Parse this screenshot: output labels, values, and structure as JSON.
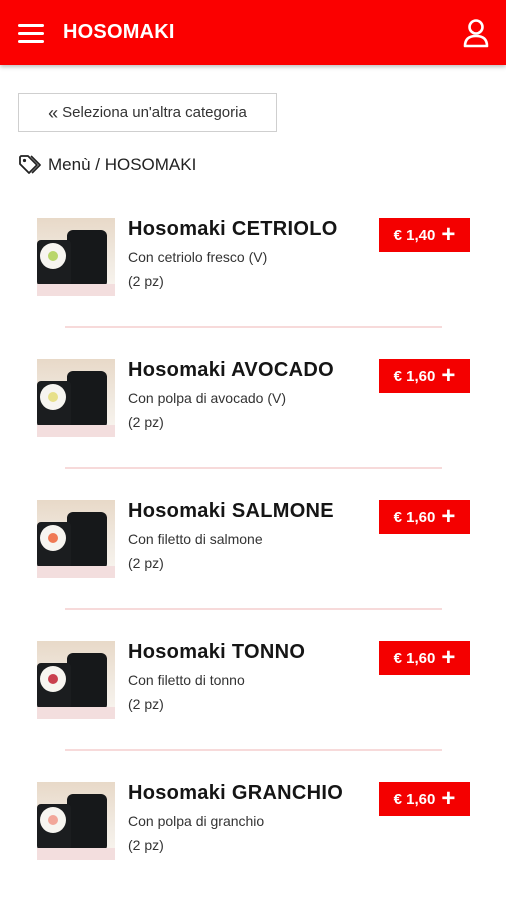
{
  "header": {
    "title": "HOSOMAKI",
    "menu_icon": "hamburger-menu-icon",
    "user_icon": "user-icon",
    "background_color": "#fb0000"
  },
  "back_button": {
    "icon": "double-chevron-left-icon",
    "label": "Seleziona un'altra categoria"
  },
  "breadcrumb": {
    "icon": "tag-icon",
    "text": "Menù / HOSOMAKI"
  },
  "products": [
    {
      "name": "Hosomaki CETRIOLO",
      "description": "Con cetriolo fresco (V)",
      "quantity": "(2 pz)",
      "price": "€ 1,40",
      "filling_color": "#b9d66a"
    },
    {
      "name": "Hosomaki AVOCADO",
      "description": "Con polpa di avocado (V)",
      "quantity": "(2 pz)",
      "price": "€ 1,60",
      "filling_color": "#e7e08a"
    },
    {
      "name": "Hosomaki SALMONE",
      "description": "Con filetto di salmone",
      "quantity": "(2 pz)",
      "price": "€ 1,60",
      "filling_color": "#f07a55"
    },
    {
      "name": "Hosomaki TONNO",
      "description": "Con filetto di tonno",
      "quantity": "(2 pz)",
      "price": "€ 1,60",
      "filling_color": "#c9404f"
    },
    {
      "name": "Hosomaki GRANCHIO",
      "description": "Con polpa di granchio",
      "quantity": "(2 pz)",
      "price": "€ 1,60",
      "filling_color": "#f2a79a"
    }
  ],
  "accent_color": "#f40000",
  "divider_color": "#f7dada"
}
